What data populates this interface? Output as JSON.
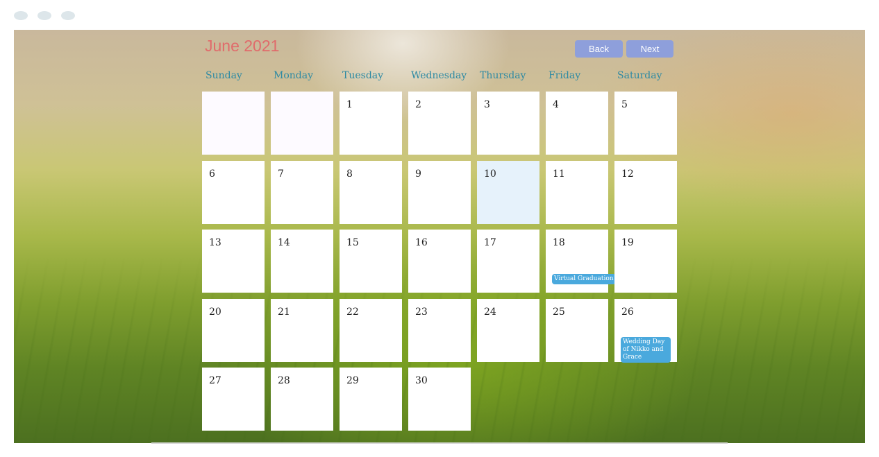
{
  "calendar": {
    "month_title": "June 2021",
    "back_label": "Back",
    "next_label": "Next",
    "weekdays": [
      "Sunday",
      "Monday",
      "Tuesday",
      "Wednesday",
      "Thursday",
      "Friday",
      "Saturday"
    ],
    "days": [
      "1",
      "2",
      "3",
      "4",
      "5",
      "6",
      "7",
      "8",
      "9",
      "10",
      "11",
      "12",
      "13",
      "14",
      "15",
      "16",
      "17",
      "18",
      "19",
      "20",
      "21",
      "22",
      "23",
      "24",
      "25",
      "26",
      "27",
      "28",
      "29",
      "30"
    ],
    "highlighted_day": "10",
    "events": [
      {
        "day": "18",
        "title": "Virtual Graduation"
      },
      {
        "day": "26",
        "title": "Wedding Day of Nikko and Grace"
      }
    ]
  },
  "colors": {
    "title": "#e06b6b",
    "weekday": "#2e8aa3",
    "button": "#8e9fdb",
    "event": "#4aa9dd",
    "today": "#e6f2fb"
  }
}
